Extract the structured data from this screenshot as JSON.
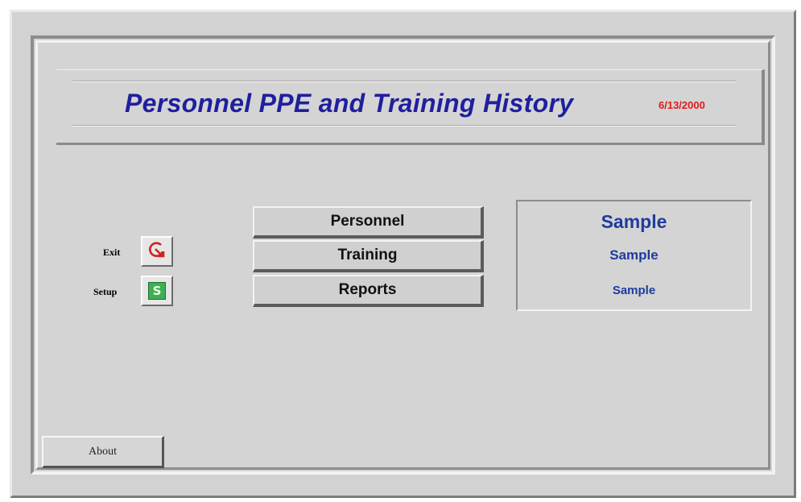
{
  "header": {
    "title": "Personnel PPE and Training History",
    "date": "6/13/2000"
  },
  "side_actions": {
    "exit_label": "Exit",
    "exit_icon": "exit-icon",
    "setup_label": "Setup",
    "setup_icon": "setup-icon",
    "setup_glyph": "S"
  },
  "main_menu": {
    "personnel_label": "Personnel",
    "training_label": "Training",
    "reports_label": "Reports"
  },
  "sample_panel": {
    "line1": "Sample",
    "line2": "Sample",
    "line3": "Sample"
  },
  "footer": {
    "about_label": "About"
  },
  "colors": {
    "title": "#1f1f9e",
    "date": "#e01b1b",
    "sample": "#1d3c9c",
    "background": "#d4d4d4"
  }
}
